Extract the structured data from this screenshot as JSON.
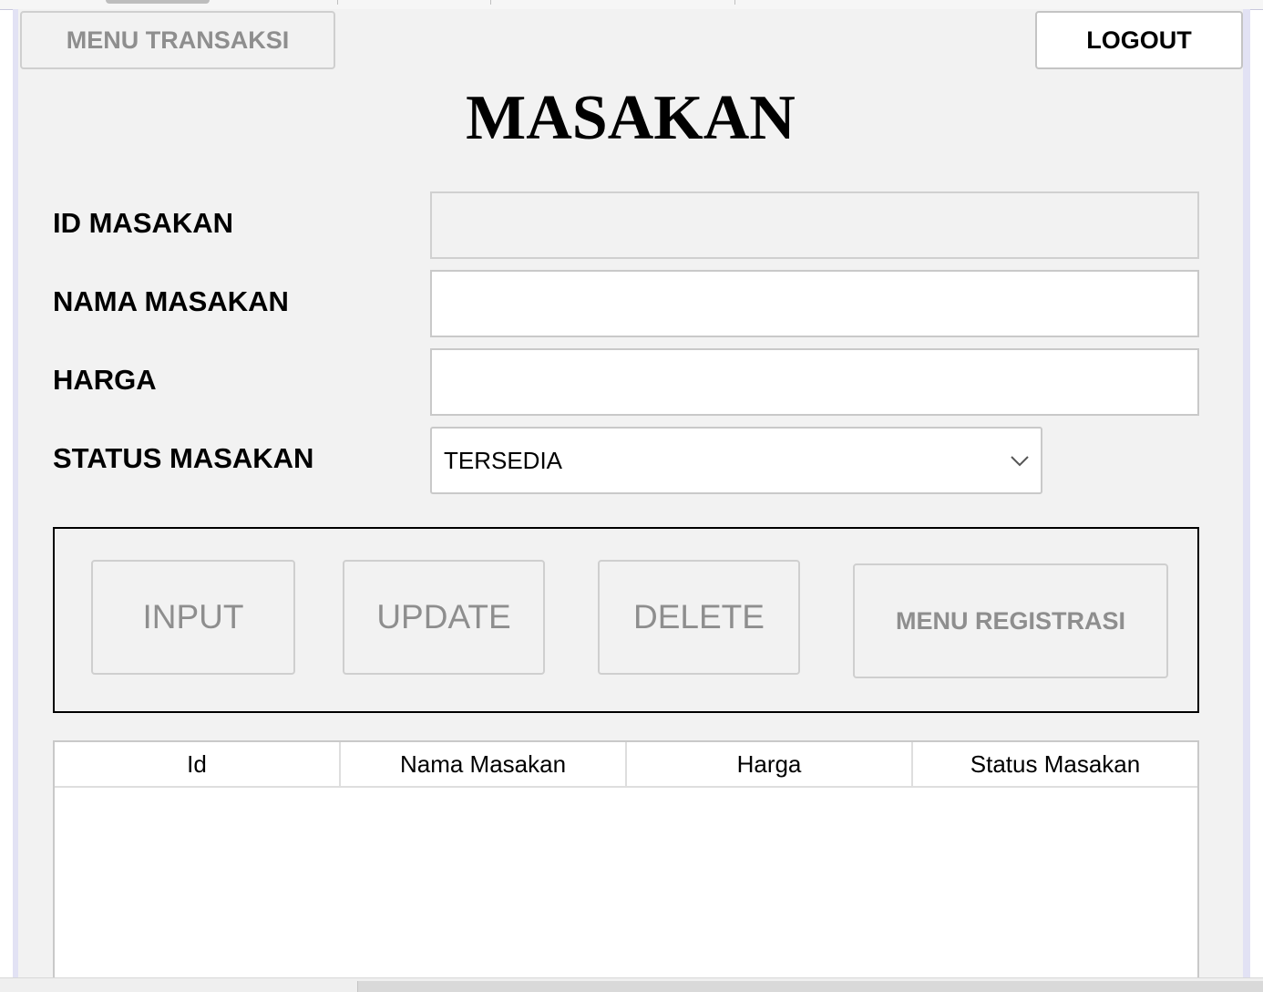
{
  "header": {
    "menu_transaksi_label": "MENU TRANSAKSI",
    "logout_label": "LOGOUT"
  },
  "page": {
    "title": "MASAKAN"
  },
  "form": {
    "id_label": "ID MASAKAN",
    "id_value": "",
    "nama_label": "NAMA MASAKAN",
    "nama_value": "",
    "harga_label": "HARGA",
    "harga_value": "",
    "status_label": "STATUS MASAKAN",
    "status_selected": "TERSEDIA"
  },
  "actions": {
    "input_label": "INPUT",
    "update_label": "UPDATE",
    "delete_label": "DELETE",
    "registrasi_label": "MENU REGISTRASI"
  },
  "table": {
    "columns": [
      "Id",
      "Nama Masakan",
      "Harga",
      "Status Masakan"
    ],
    "rows": []
  },
  "icons": {
    "select_arrow": "chevron-down-icon"
  },
  "colors": {
    "panel_bg": "#f2f2f2",
    "disabled_text": "#8e8e8e",
    "frame_accent": "#e2e2f4"
  }
}
